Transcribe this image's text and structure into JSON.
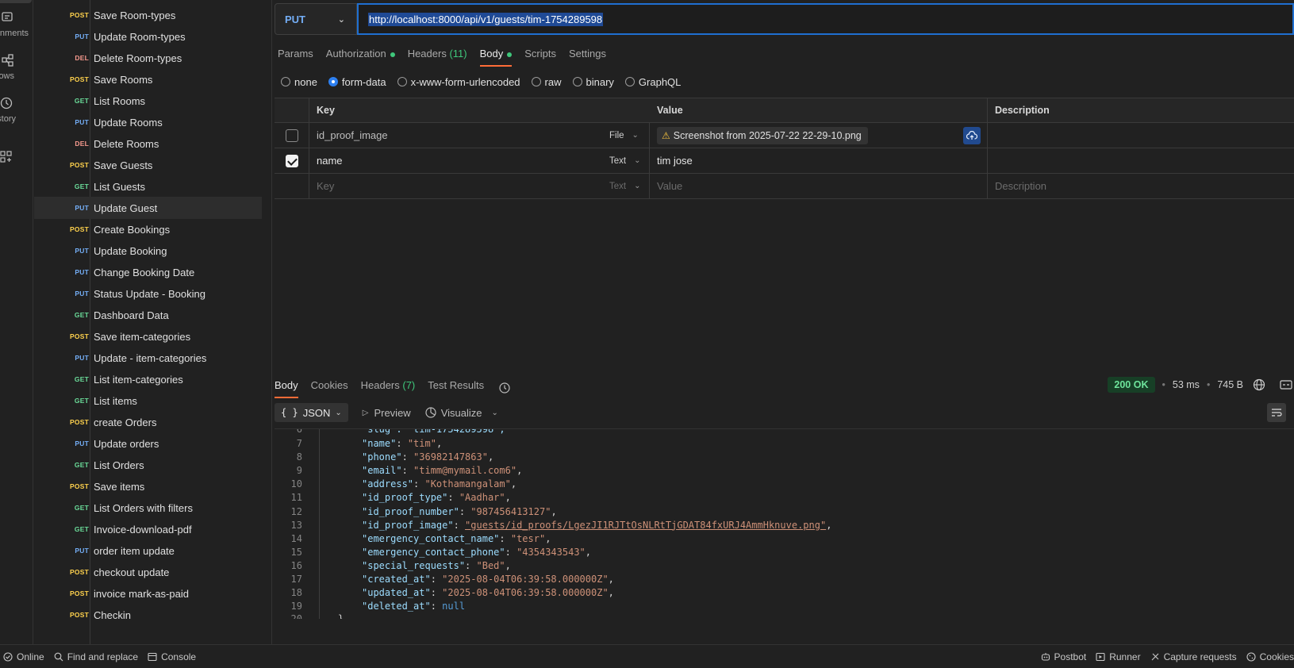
{
  "rail": {
    "items": [
      {
        "label": "nments",
        "icon": "environment-icon"
      },
      {
        "label": "ows",
        "icon": "flows-icon"
      },
      {
        "label": "story",
        "icon": "history-icon"
      },
      {
        "label": "",
        "icon": "add-apps-icon"
      }
    ]
  },
  "sidebar": {
    "requests": [
      {
        "method": "POST",
        "name": "Save Room-types"
      },
      {
        "method": "PUT",
        "name": "Update Room-types"
      },
      {
        "method": "DEL",
        "name": "Delete Room-types"
      },
      {
        "method": "POST",
        "name": "Save Rooms"
      },
      {
        "method": "GET",
        "name": "List Rooms"
      },
      {
        "method": "PUT",
        "name": "Update Rooms"
      },
      {
        "method": "DEL",
        "name": "Delete Rooms"
      },
      {
        "method": "POST",
        "name": "Save Guests"
      },
      {
        "method": "GET",
        "name": "List Guests"
      },
      {
        "method": "PUT",
        "name": "Update Guest"
      },
      {
        "method": "POST",
        "name": "Create Bookings"
      },
      {
        "method": "PUT",
        "name": "Update Booking"
      },
      {
        "method": "PUT",
        "name": "Change Booking Date"
      },
      {
        "method": "PUT",
        "name": "Status Update - Booking"
      },
      {
        "method": "GET",
        "name": "Dashboard Data"
      },
      {
        "method": "POST",
        "name": "Save item-categories"
      },
      {
        "method": "PUT",
        "name": "Update - item-categories"
      },
      {
        "method": "GET",
        "name": "List item-categories"
      },
      {
        "method": "GET",
        "name": "List items"
      },
      {
        "method": "POST",
        "name": "create Orders"
      },
      {
        "method": "PUT",
        "name": "Update orders"
      },
      {
        "method": "GET",
        "name": "List Orders"
      },
      {
        "method": "POST",
        "name": "Save items"
      },
      {
        "method": "GET",
        "name": "List Orders with filters"
      },
      {
        "method": "GET",
        "name": "Invoice-download-pdf"
      },
      {
        "method": "PUT",
        "name": "order item update"
      },
      {
        "method": "POST",
        "name": "checkout update"
      },
      {
        "method": "POST",
        "name": "invoice mark-as-paid"
      },
      {
        "method": "POST",
        "name": "Checkin"
      }
    ],
    "active_index": 9
  },
  "request": {
    "method": "PUT",
    "url": "http://localhost:8000/api/v1/guests/tim-1754289598",
    "tabs": [
      {
        "label": "Params"
      },
      {
        "label": "Authorization"
      },
      {
        "label": "Headers",
        "count": "(11)"
      },
      {
        "label": "Body"
      },
      {
        "label": "Scripts"
      },
      {
        "label": "Settings"
      }
    ],
    "body_types": [
      "none",
      "form-data",
      "x-www-form-urlencoded",
      "raw",
      "binary",
      "GraphQL"
    ],
    "body_type_selected": "form-data",
    "table": {
      "headers": {
        "key": "Key",
        "value": "Value",
        "description": "Description"
      },
      "rows": [
        {
          "checked": false,
          "key": "id_proof_image",
          "type": "File",
          "value": "Screenshot from 2025-07-22 22-29-10.png"
        },
        {
          "checked": true,
          "key": "name",
          "type": "Text",
          "value": "tim jose"
        }
      ],
      "placeholder": {
        "key": "Key",
        "type": "Text",
        "value": "Value",
        "description": "Description"
      }
    }
  },
  "response": {
    "tabs": [
      {
        "label": "Body"
      },
      {
        "label": "Cookies"
      },
      {
        "label": "Headers",
        "count": "(7)"
      },
      {
        "label": "Test Results"
      }
    ],
    "status": "200 OK",
    "time": "53 ms",
    "size": "745 B",
    "format": "JSON",
    "preview": "Preview",
    "visualize": "Visualize",
    "lines": [
      {
        "n": "7",
        "k": "\"name\"",
        "v": "\"tim\"",
        "type": "s"
      },
      {
        "n": "8",
        "k": "\"phone\"",
        "v": "\"36982147863\"",
        "type": "s"
      },
      {
        "n": "9",
        "k": "\"email\"",
        "v": "\"timm@mymail.com6\"",
        "type": "s"
      },
      {
        "n": "10",
        "k": "\"address\"",
        "v": "\"Kothamangalam\"",
        "type": "s"
      },
      {
        "n": "11",
        "k": "\"id_proof_type\"",
        "v": "\"Aadhar\"",
        "type": "s"
      },
      {
        "n": "12",
        "k": "\"id_proof_number\"",
        "v": "\"987456413127\"",
        "type": "s"
      },
      {
        "n": "13",
        "k": "\"id_proof_image\"",
        "v": "\"guests/id_proofs/LgezJI1RJTtOsNLRtTjGDAT84fxURJ4AmmHknuve.png\"",
        "type": "link"
      },
      {
        "n": "14",
        "k": "\"emergency_contact_name\"",
        "v": "\"tesr\"",
        "type": "s"
      },
      {
        "n": "15",
        "k": "\"emergency_contact_phone\"",
        "v": "\"4354343543\"",
        "type": "s"
      },
      {
        "n": "16",
        "k": "\"special_requests\"",
        "v": "\"Bed\"",
        "type": "s"
      },
      {
        "n": "17",
        "k": "\"created_at\"",
        "v": "\"2025-08-04T06:39:58.000000Z\"",
        "type": "s"
      },
      {
        "n": "18",
        "k": "\"updated_at\"",
        "v": "\"2025-08-04T06:39:58.000000Z\"",
        "type": "s"
      },
      {
        "n": "19",
        "k": "\"deleted_at\"",
        "v": "null",
        "type": "n"
      }
    ]
  },
  "statusbar": {
    "online": "Online",
    "find_replace": "Find and replace",
    "console": "Console",
    "postbot": "Postbot",
    "runner": "Runner",
    "capture": "Capture requests",
    "cookies": "Cookies"
  },
  "colors": {
    "post": "#ffd24d",
    "put": "#74aef6",
    "get": "#6bdd9a",
    "del": "#f79a8e",
    "accent": "#ff6c37",
    "status_ok": "#6ee49b"
  }
}
